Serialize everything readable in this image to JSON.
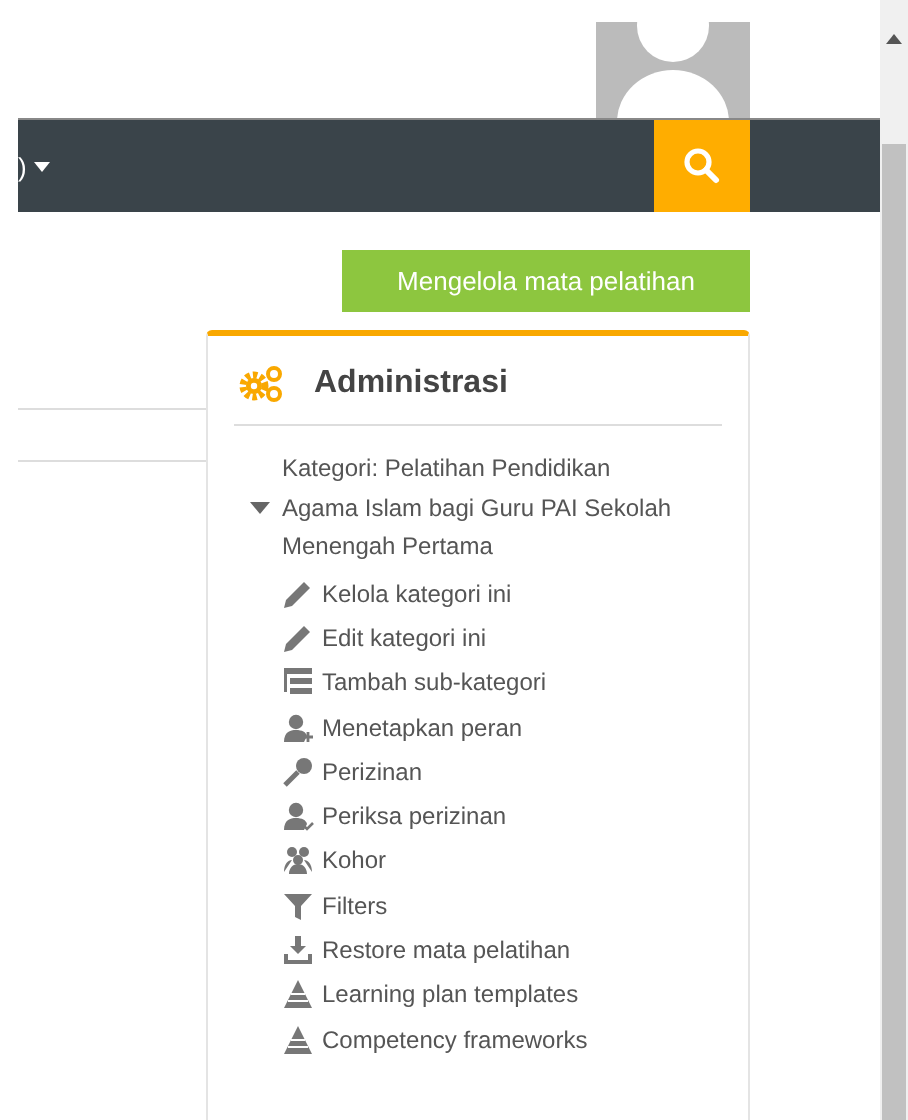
{
  "navbar": {
    "menu_text": ")"
  },
  "manage_button": "Mengelola mata pelatihan",
  "block": {
    "title": "Administrasi",
    "tree": {
      "label": "Kategori: Pelatihan Pendidikan Agama Islam bagi Guru PAI Sekolah Menengah Pertama",
      "expanded": true,
      "children": [
        {
          "label": "Kelola kategori ini",
          "kind": "pencil"
        },
        {
          "label": "Edit kategori ini",
          "kind": "pencil"
        },
        {
          "label": "Tambah sub-kategori",
          "kind": "subcategory"
        },
        {
          "label": "Menetapkan peran",
          "kind": "user-plus"
        },
        {
          "label": "Perizinan",
          "kind": "key"
        },
        {
          "label": "Periksa perizinan",
          "kind": "user-check"
        },
        {
          "label": "Kohor",
          "kind": "users"
        },
        {
          "label": "Filters",
          "kind": "filter"
        },
        {
          "label": "Restore mata pelatihan",
          "kind": "download"
        },
        {
          "label": "Learning plan templates",
          "kind": "pyramid"
        },
        {
          "label": "Competency frameworks",
          "kind": "pyramid"
        }
      ]
    }
  }
}
